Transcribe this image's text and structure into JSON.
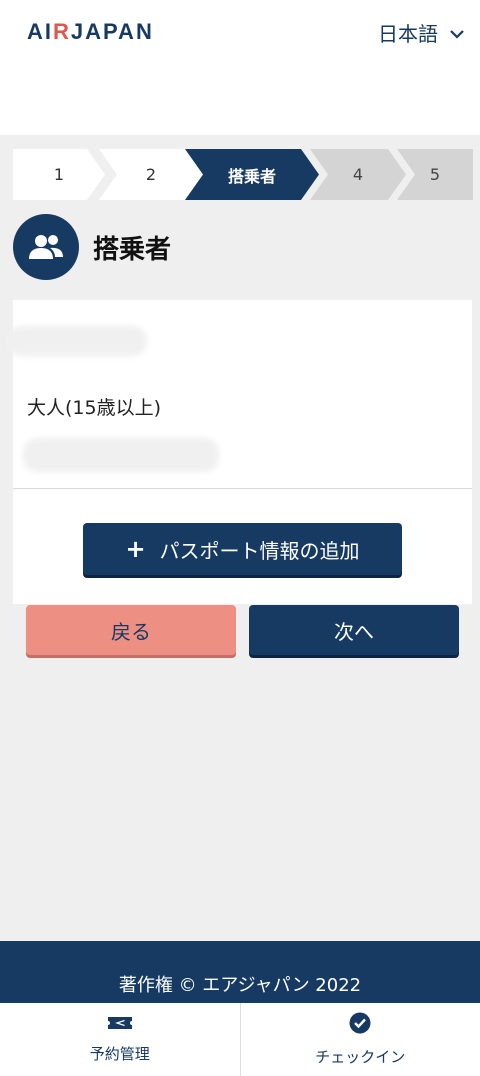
{
  "header": {
    "logo_prefix": "AI",
    "logo_accent": "R",
    "logo_suffix": "JAPAN",
    "language": "日本語"
  },
  "steps": [
    {
      "label": "1",
      "state": "done"
    },
    {
      "label": "2",
      "state": "done"
    },
    {
      "label": "搭乗者",
      "state": "active"
    },
    {
      "label": "4",
      "state": "pending"
    },
    {
      "label": "5",
      "state": "pending"
    }
  ],
  "section": {
    "title": "搭乗者",
    "icon": "users-icon"
  },
  "passenger": {
    "type": "大人(15歳以上)",
    "add_passport_label": "パスポート情報の追加"
  },
  "actions": {
    "back_label": "戻る",
    "next_label": "次へ"
  },
  "footer": {
    "copyright": "著作権 © エアジャパン 2022"
  },
  "bottom_nav": {
    "items": [
      {
        "label": "予約管理",
        "icon": "ticket-plane-icon"
      },
      {
        "label": "チェックイン",
        "icon": "check-circle-icon"
      }
    ]
  },
  "colors": {
    "brand_navy": "#173a63",
    "accent_coral": "#ee8f84",
    "logo_red": "#e2574c"
  }
}
